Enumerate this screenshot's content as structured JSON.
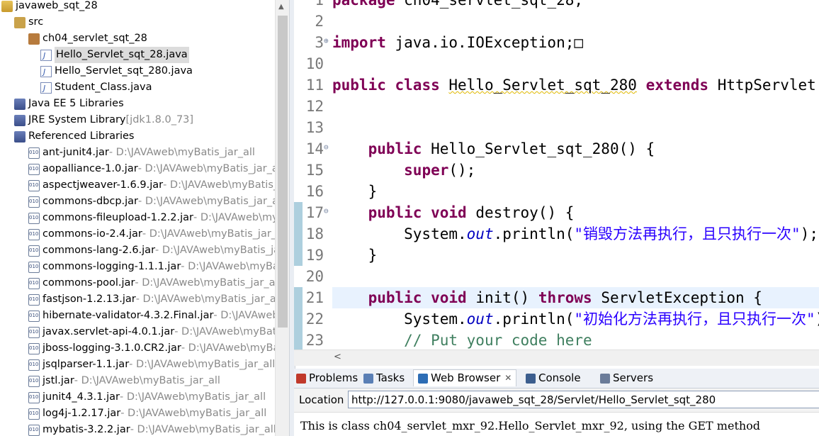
{
  "explorer": {
    "items": [
      {
        "label": "javaweb_sqt_28",
        "path": "",
        "icon": "project-icon",
        "indent": 0
      },
      {
        "label": "src",
        "path": "",
        "icon": "source-folder-icon",
        "indent": 1
      },
      {
        "label": "ch04_servlet_sqt_28",
        "path": "",
        "icon": "package-icon",
        "indent": 2
      },
      {
        "label": "Hello_Servlet_sqt_28.java",
        "path": "",
        "icon": "java-file-icon",
        "indent": 3,
        "selected": true
      },
      {
        "label": "Hello_Servlet_sqt_280.java",
        "path": "",
        "icon": "java-file-icon",
        "indent": 3
      },
      {
        "label": "Student_Class.java",
        "path": "",
        "icon": "java-file-icon",
        "indent": 3
      },
      {
        "label": "Java EE 5 Libraries",
        "path": "",
        "icon": "library-icon",
        "indent": 1
      },
      {
        "label": "JRE System Library",
        "path": "[jdk1.8.0_73]",
        "icon": "library-icon",
        "indent": 1
      },
      {
        "label": "Referenced Libraries",
        "path": "",
        "icon": "library-icon",
        "indent": 1
      },
      {
        "label": "ant-junit4.jar",
        "path": " - D:\\JAVAweb\\myBatis_jar_all",
        "icon": "jar-icon",
        "indent": 2
      },
      {
        "label": "aopalliance-1.0.jar",
        "path": " - D:\\JAVAweb\\myBatis_jar_all",
        "icon": "jar-icon",
        "indent": 2
      },
      {
        "label": "aspectjweaver-1.6.9.jar",
        "path": " - D:\\JAVAweb\\myBatis_jar_all",
        "icon": "jar-icon",
        "indent": 2
      },
      {
        "label": "commons-dbcp.jar",
        "path": " - D:\\JAVAweb\\myBatis_jar_all",
        "icon": "jar-icon",
        "indent": 2
      },
      {
        "label": "commons-fileupload-1.2.2.jar",
        "path": " - D:\\JAVAweb\\myBatis_jar_all",
        "icon": "jar-icon",
        "indent": 2
      },
      {
        "label": "commons-io-2.4.jar",
        "path": " - D:\\JAVAweb\\myBatis_jar_all",
        "icon": "jar-icon",
        "indent": 2
      },
      {
        "label": "commons-lang-2.6.jar",
        "path": " - D:\\JAVAweb\\myBatis_jar_all",
        "icon": "jar-icon",
        "indent": 2
      },
      {
        "label": "commons-logging-1.1.1.jar",
        "path": " - D:\\JAVAweb\\myBatis_jar_all",
        "icon": "jar-icon",
        "indent": 2
      },
      {
        "label": "commons-pool.jar",
        "path": " - D:\\JAVAweb\\myBatis_jar_all",
        "icon": "jar-icon",
        "indent": 2
      },
      {
        "label": "fastjson-1.2.13.jar",
        "path": " - D:\\JAVAweb\\myBatis_jar_all",
        "icon": "jar-icon",
        "indent": 2
      },
      {
        "label": "hibernate-validator-4.3.2.Final.jar",
        "path": " - D:\\JAVAweb\\myBatis_jar_all",
        "icon": "jar-icon",
        "indent": 2
      },
      {
        "label": "javax.servlet-api-4.0.1.jar",
        "path": " - D:\\JAVAweb\\myBatis_jar_all",
        "icon": "jar-icon",
        "indent": 2
      },
      {
        "label": "jboss-logging-3.1.0.CR2.jar",
        "path": " - D:\\JAVAweb\\myBatis_jar_all",
        "icon": "jar-icon",
        "indent": 2
      },
      {
        "label": "jsqlparser-1.1.jar",
        "path": " - D:\\JAVAweb\\myBatis_jar_all",
        "icon": "jar-icon",
        "indent": 2
      },
      {
        "label": "jstl.jar",
        "path": " - D:\\JAVAweb\\myBatis_jar_all",
        "icon": "jar-icon",
        "indent": 2
      },
      {
        "label": "junit4_4.3.1.jar",
        "path": " - D:\\JAVAweb\\myBatis_jar_all",
        "icon": "jar-icon",
        "indent": 2
      },
      {
        "label": "log4j-1.2.17.jar",
        "path": " - D:\\JAVAweb\\myBatis_jar_all",
        "icon": "jar-icon",
        "indent": 2
      },
      {
        "label": "mybatis-3.2.2.jar",
        "path": " - D:\\JAVAweb\\myBatis_jar_all",
        "icon": "jar-icon",
        "indent": 2
      }
    ]
  },
  "editor": {
    "lines": [
      {
        "num": "1",
        "fold": "",
        "code": [
          {
            "t": "package",
            "c": "kw"
          },
          {
            "t": " ch04_servlet_sqt_28;",
            "c": ""
          }
        ]
      },
      {
        "num": "2",
        "fold": "",
        "code": []
      },
      {
        "num": "3",
        "fold": "⊕",
        "code": [
          {
            "t": "import",
            "c": "kw"
          },
          {
            "t": " java.io.IOException;",
            "c": ""
          },
          {
            "t": "□",
            "c": ""
          }
        ]
      },
      {
        "num": "10",
        "fold": "",
        "code": []
      },
      {
        "num": "11",
        "fold": "",
        "code": [
          {
            "t": "public",
            "c": "kw"
          },
          {
            "t": " ",
            "c": ""
          },
          {
            "t": "class",
            "c": "kw"
          },
          {
            "t": " ",
            "c": ""
          },
          {
            "t": "Hello_Servlet_sqt_280",
            "c": "warn"
          },
          {
            "t": " ",
            "c": ""
          },
          {
            "t": "extends",
            "c": "kw"
          },
          {
            "t": " HttpServlet {",
            "c": ""
          }
        ]
      },
      {
        "num": "12",
        "fold": "",
        "code": []
      },
      {
        "num": "13",
        "fold": "",
        "code": []
      },
      {
        "num": "14",
        "fold": "⊖",
        "code": [
          {
            "t": "    ",
            "c": ""
          },
          {
            "t": "public",
            "c": "kw"
          },
          {
            "t": " Hello_Servlet_sqt_280() {",
            "c": ""
          }
        ]
      },
      {
        "num": "15",
        "fold": "",
        "code": [
          {
            "t": "        ",
            "c": ""
          },
          {
            "t": "super",
            "c": "kw"
          },
          {
            "t": "();",
            "c": ""
          }
        ]
      },
      {
        "num": "16",
        "fold": "",
        "code": [
          {
            "t": "    }",
            "c": ""
          }
        ]
      },
      {
        "num": "17",
        "fold": "⊖",
        "code": [
          {
            "t": "    ",
            "c": ""
          },
          {
            "t": "public",
            "c": "kw"
          },
          {
            "t": " ",
            "c": ""
          },
          {
            "t": "void",
            "c": "kw"
          },
          {
            "t": " destroy() {",
            "c": ""
          }
        ]
      },
      {
        "num": "18",
        "fold": "",
        "code": [
          {
            "t": "        System.",
            "c": ""
          },
          {
            "t": "out",
            "c": "fld"
          },
          {
            "t": ".println(",
            "c": ""
          },
          {
            "t": "\"销毁方法再执行，且只执行一次\"",
            "c": "str"
          },
          {
            "t": ");",
            "c": ""
          }
        ]
      },
      {
        "num": "19",
        "fold": "",
        "code": [
          {
            "t": "    }",
            "c": ""
          }
        ]
      },
      {
        "num": "20",
        "fold": "",
        "code": []
      },
      {
        "num": "21",
        "fold": "",
        "code": [
          {
            "t": "    ",
            "c": ""
          },
          {
            "t": "public",
            "c": "kw"
          },
          {
            "t": " ",
            "c": ""
          },
          {
            "t": "void",
            "c": "kw"
          },
          {
            "t": " init() ",
            "c": ""
          },
          {
            "t": "throws",
            "c": "kw"
          },
          {
            "t": " ServletException {",
            "c": ""
          }
        ]
      },
      {
        "num": "22",
        "fold": "",
        "code": [
          {
            "t": "        System.",
            "c": ""
          },
          {
            "t": "out",
            "c": "fld"
          },
          {
            "t": ".println(",
            "c": ""
          },
          {
            "t": "\"初始化方法再执行，且只执行一次\"",
            "c": "str"
          },
          {
            "t": ");",
            "c": ""
          }
        ]
      },
      {
        "num": "23",
        "fold": "",
        "code": [
          {
            "t": "        ",
            "c": ""
          },
          {
            "t": "// Put your code here",
            "c": "cmt"
          }
        ]
      }
    ]
  },
  "hscroll": {
    "left_arrow": "<"
  },
  "tabs": [
    {
      "label": "Problems",
      "icon": "problems-icon",
      "color": "#c0392b"
    },
    {
      "label": "Tasks",
      "icon": "tasks-icon",
      "color": "#5a7fb5"
    },
    {
      "label": "Web Browser",
      "icon": "globe-icon",
      "color": "#2d6db5",
      "active": true,
      "close": "✕"
    },
    {
      "label": "Console",
      "icon": "console-icon",
      "color": "#3c5e8e"
    },
    {
      "label": "Servers",
      "icon": "servers-icon",
      "color": "#6b7c99"
    }
  ],
  "browser": {
    "location_label": "Location",
    "url": "http://127.0.0.1:9080/javaweb_sqt_28/Servlet/Hello_Servlet_sqt_280",
    "content": "This is class ch04_servlet_mxr_92.Hello_Servlet_mxr_92, using the GET method"
  }
}
